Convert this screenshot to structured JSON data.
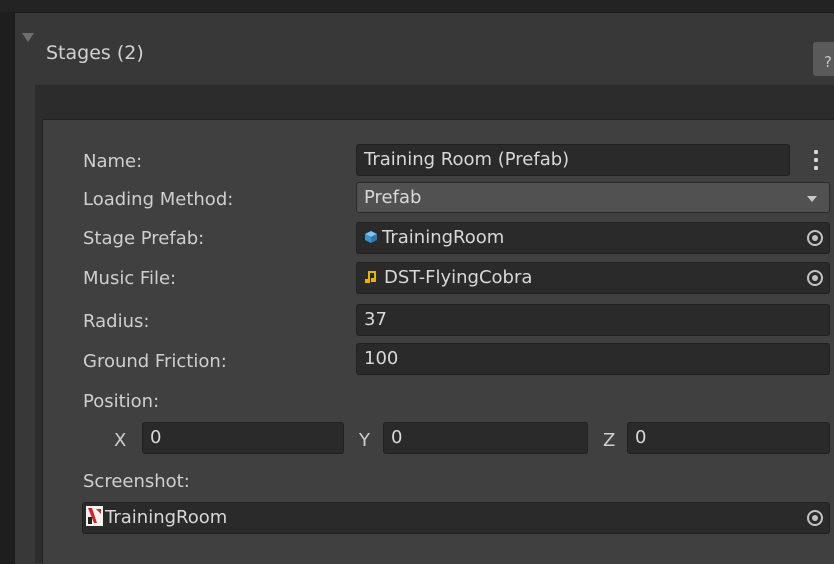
{
  "foldout": {
    "title": "Stages (2)",
    "help": "?"
  },
  "stage": {
    "fields": [
      {
        "label": "Name:",
        "value": "Training Room (Prefab)"
      },
      {
        "label": "Loading Method:",
        "value": "Prefab"
      },
      {
        "label": "Stage Prefab:",
        "value": "TrainingRoom",
        "icon": "prefab-cube-icon"
      },
      {
        "label": "Music File:",
        "value": "DST-FlyingCobra",
        "icon": "audio-clip-icon"
      },
      {
        "label": "Radius:",
        "value": "37"
      },
      {
        "label": "Ground Friction:",
        "value": "100"
      }
    ],
    "position": {
      "label": "Position:",
      "x_label": "X",
      "x": "0",
      "y_label": "Y",
      "y": "0",
      "z_label": "Z",
      "z": "0"
    },
    "screenshot": {
      "label": "Screenshot:",
      "value": "TrainingRoom",
      "icon": "texture-icon"
    }
  },
  "colors": {
    "prefab_icon": "#48a6d8",
    "audio_icon": "#e8b400",
    "texture_icon": "#d92020"
  }
}
